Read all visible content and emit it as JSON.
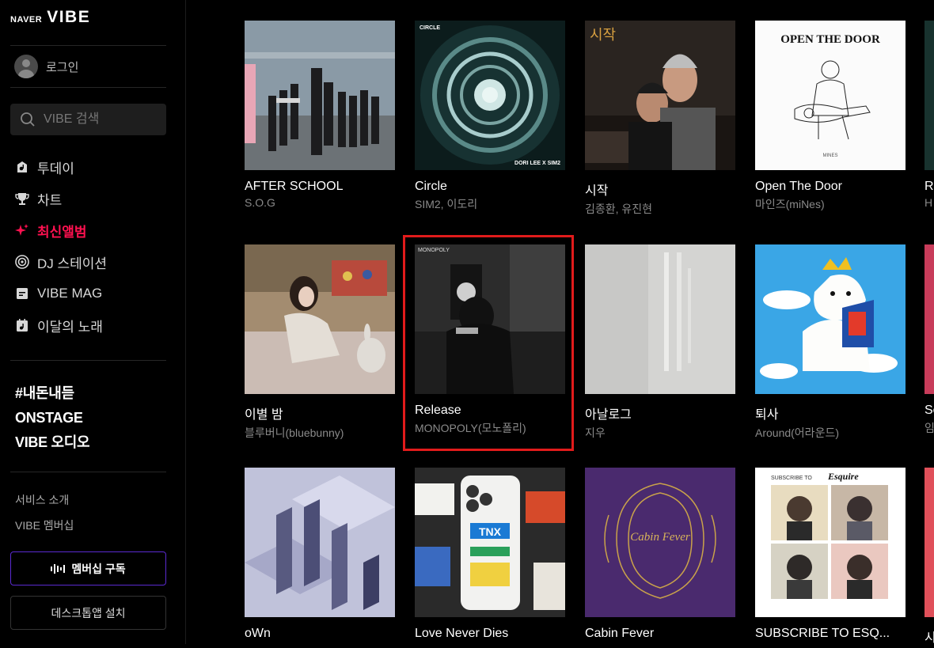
{
  "brand": {
    "naver": "NAVER",
    "vibe": "VIBE"
  },
  "account": {
    "login_label": "로그인"
  },
  "search": {
    "placeholder": "VIBE 검색"
  },
  "nav": [
    {
      "label": "투데이",
      "icon": "today-icon"
    },
    {
      "label": "차트",
      "icon": "trophy-icon"
    },
    {
      "label": "최신앨범",
      "icon": "sparkle-icon",
      "active": true
    },
    {
      "label": "DJ 스테이션",
      "icon": "radio-icon"
    },
    {
      "label": "VIBE MAG",
      "icon": "document-icon"
    },
    {
      "label": "이달의 노래",
      "icon": "music-note-icon"
    }
  ],
  "brand_links": [
    "#내돈내듣",
    "ONSTAGE",
    "VIBE 오디오"
  ],
  "small_links": [
    "서비스 소개",
    "VIBE 멤버십"
  ],
  "buttons": {
    "membership": "멤버십 구독",
    "desktop": "데스크톱앱 설치"
  },
  "albums": [
    {
      "title": "AFTER SCHOOL",
      "artist": "S.O.G"
    },
    {
      "title": "Circle",
      "artist": "SIM2, 이도리",
      "cover_text": "CIRCLE",
      "cover_text2": "DORI LEE X SIM2"
    },
    {
      "title": "시작",
      "artist": "김종환, 유진현",
      "cover_text": "시작"
    },
    {
      "title": "Open The Door",
      "artist": "마인즈(miNes)",
      "cover_text": "OPEN THE DOOR",
      "cover_text2": "MINES"
    },
    {
      "title": "R",
      "artist": "H"
    },
    {
      "title": "이별 밤",
      "artist": "블루버니(bluebunny)"
    },
    {
      "title": "Release",
      "artist": "MONOPOLY(모노폴리)",
      "cover_text": "MONOPOLY"
    },
    {
      "title": "아날로그",
      "artist": "지우"
    },
    {
      "title": "퇴사",
      "artist": "Around(어라운드)"
    },
    {
      "title": "Se",
      "artist": "임"
    },
    {
      "title": "oWn",
      "artist": ""
    },
    {
      "title": "Love Never Dies",
      "artist": "",
      "cover_text": "TNX"
    },
    {
      "title": "Cabin Fever",
      "artist": "",
      "cover_text": "Cabin Fever"
    },
    {
      "title": "SUBSCRIBE TO ESQ...",
      "artist": "",
      "cover_text": "SUBSCRIBE TO",
      "cover_text2": "Esquire"
    },
    {
      "title": "시",
      "artist": ""
    }
  ],
  "colors": {
    "accent": "#ff1150",
    "highlight": "#e11b1b",
    "membership_border": "#5a2ad0"
  }
}
